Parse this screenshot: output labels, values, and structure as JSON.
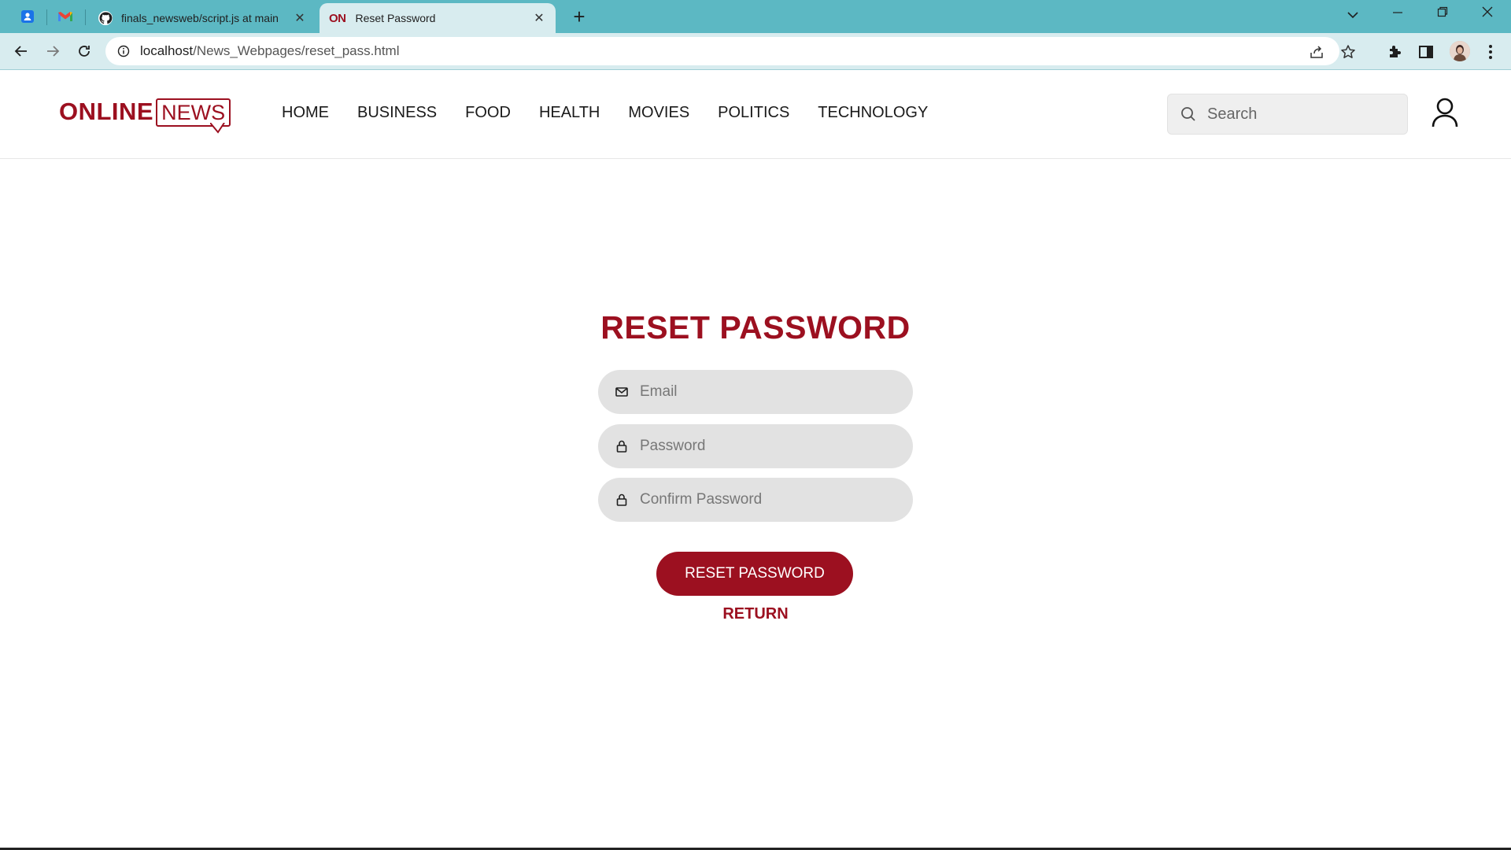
{
  "browser": {
    "tabs": [
      {
        "title": "finals_newsweb/script.js at main",
        "icon": "github-icon",
        "active": false
      },
      {
        "title": "Reset Password",
        "favicon_text": "ON",
        "active": true
      }
    ],
    "url_host": "localhost",
    "url_path": "/News_Webpages/reset_pass.html",
    "accent_color": "#5cb8c3"
  },
  "header": {
    "logo_online": "ONLINE",
    "logo_news": "NEWS",
    "nav": [
      "HOME",
      "BUSINESS",
      "FOOD",
      "HEALTH",
      "MOVIES",
      "POLITICS",
      "TECHNOLOGY"
    ],
    "search_placeholder": "Search"
  },
  "form": {
    "title": "RESET PASSWORD",
    "email_placeholder": "Email",
    "password_placeholder": "Password",
    "confirm_placeholder": "Confirm Password",
    "submit_label": "RESET PASSWORD",
    "return_label": "RETURN",
    "brand_color": "#9c1020"
  }
}
